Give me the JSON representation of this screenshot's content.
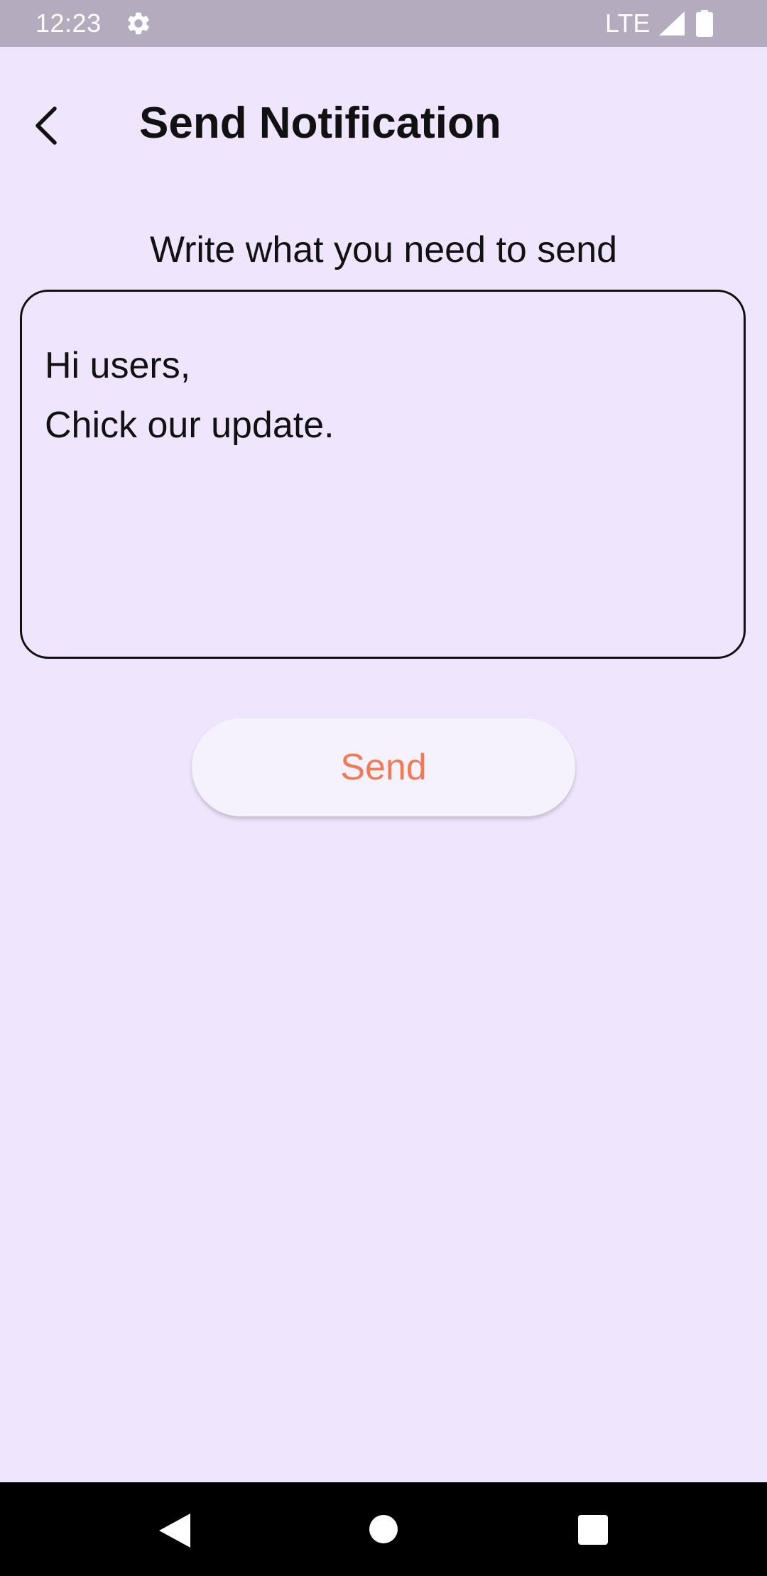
{
  "status_bar": {
    "time": "12:23",
    "network": "LTE",
    "icons": [
      "settings-gear-icon",
      "signal-icon",
      "battery-icon"
    ]
  },
  "app_bar": {
    "title": "Send Notification",
    "back_icon": "chevron-left-icon"
  },
  "form": {
    "prompt": "Write what you need to send",
    "message_value": "Hi users,\nChick our update.",
    "send_label": "Send"
  },
  "nav_bar": {
    "icons": [
      "nav-back-icon",
      "nav-home-icon",
      "nav-recents-icon"
    ]
  },
  "colors": {
    "background": "#EFE6FD",
    "status_bar": "#B5ABBE",
    "send_text": "#F07A56",
    "send_button": "#F6F2FD",
    "nav_bar": "#000000"
  }
}
